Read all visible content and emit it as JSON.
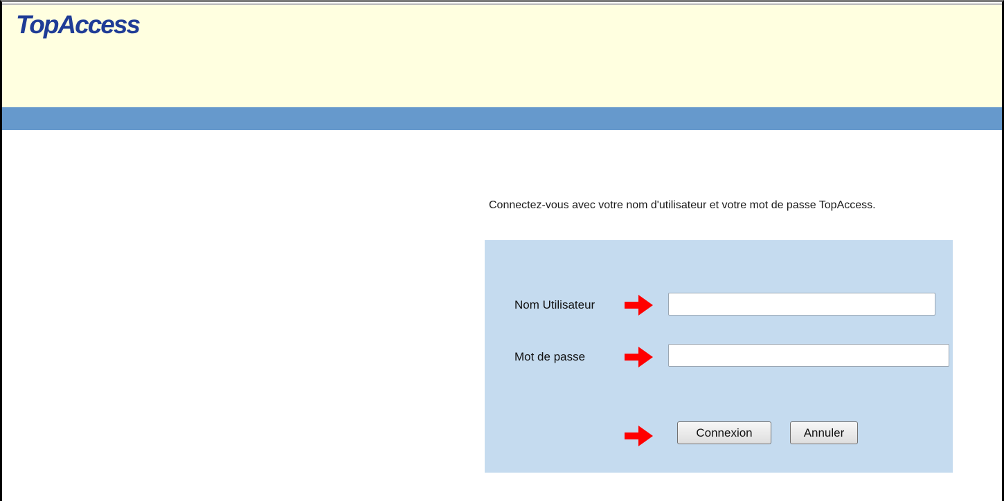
{
  "header": {
    "logo_text": "TopAccess",
    "logo_color": "#1f3c96",
    "background_color": "#ffffe0",
    "bar_color": "#6699cc"
  },
  "main": {
    "instruction": "Connectez-vous avec votre nom d'utilisateur et votre mot de passe TopAccess."
  },
  "login": {
    "box_color": "#c5dbef",
    "username_label": "Nom Utilisateur",
    "username_value": "",
    "password_label": "Mot de passe",
    "password_value": "",
    "login_button": "Connexion",
    "cancel_button": "Annuler",
    "arrow_icon": "red-arrow-icon"
  }
}
